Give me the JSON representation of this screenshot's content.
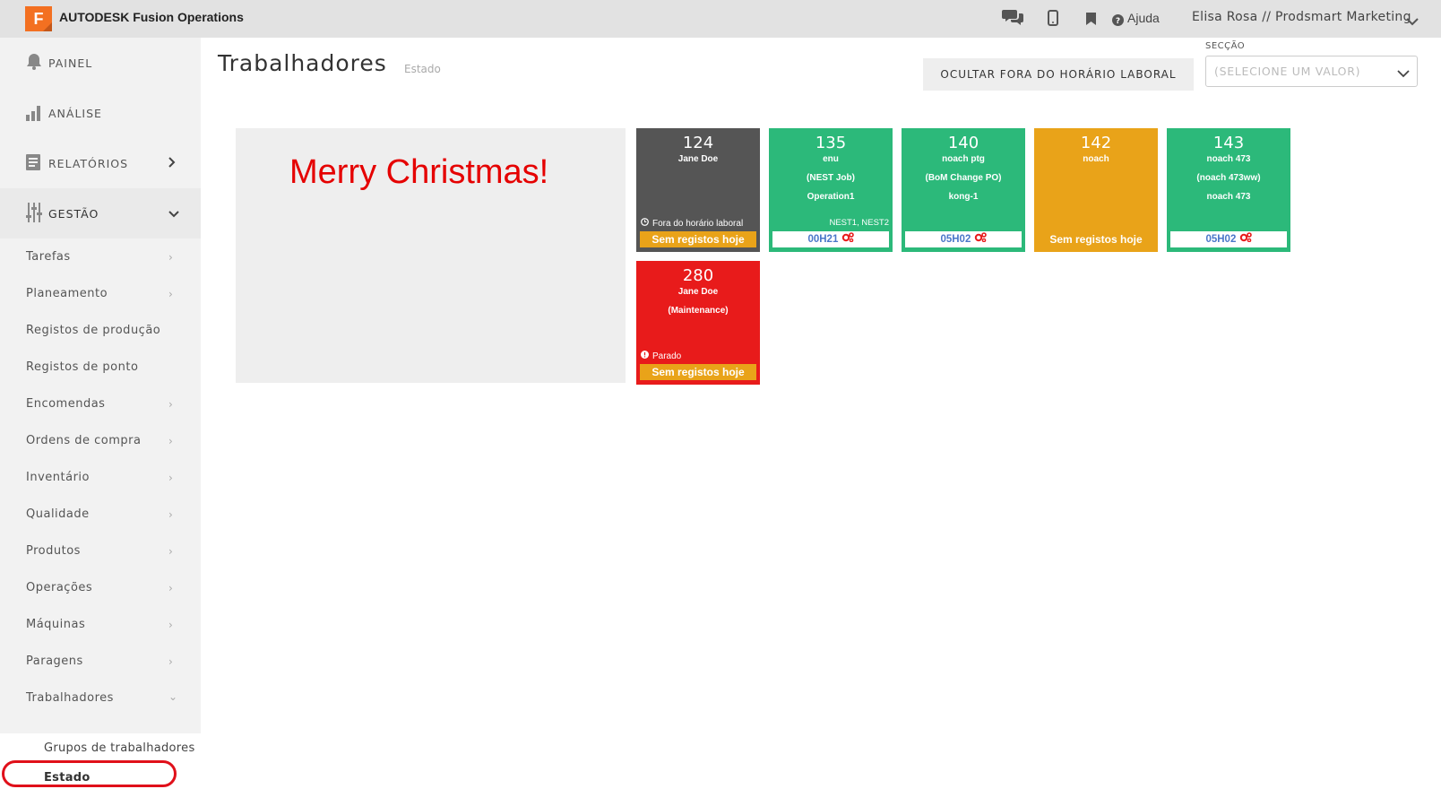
{
  "app": {
    "brand": "AUTODESK Fusion Operations",
    "logo_letter": "F",
    "help_label": "Ajuda",
    "user_label": "Elisa Rosa // Prodsmart Marketing"
  },
  "sidebar": {
    "main": [
      {
        "label": "PAINEL",
        "icon": "bell-icon"
      },
      {
        "label": "ANÁLISE",
        "icon": "bar-chart-icon"
      },
      {
        "label": "RELATÓRIOS",
        "icon": "report-icon"
      },
      {
        "label": "GESTÃO",
        "icon": "sliders-icon"
      }
    ],
    "items": [
      {
        "label": "Tarefas",
        "chevron": true
      },
      {
        "label": "Planeamento",
        "chevron": true
      },
      {
        "label": "Registos de produção",
        "chevron": false
      },
      {
        "label": "Registos de ponto",
        "chevron": false
      },
      {
        "label": "Encomendas",
        "chevron": true
      },
      {
        "label": "Ordens de compra",
        "chevron": true
      },
      {
        "label": "Inventário",
        "chevron": true
      },
      {
        "label": "Qualidade",
        "chevron": true
      },
      {
        "label": "Produtos",
        "chevron": true
      },
      {
        "label": "Operações",
        "chevron": true
      },
      {
        "label": "Máquinas",
        "chevron": true
      },
      {
        "label": "Paragens",
        "chevron": true
      },
      {
        "label": "Trabalhadores",
        "chevron": true
      }
    ],
    "subitems": [
      {
        "label": "Grupos de trabalhadores"
      },
      {
        "label": "Estado"
      }
    ]
  },
  "main": {
    "title": "Trabalhadores",
    "subtitle": "Estado",
    "hide_button": "OCULTAR FORA DO HORÁRIO LABORAL",
    "section_label": "SECÇÃO",
    "section_placeholder": "(SELECIONE UM VALOR)",
    "banner_text": "Merry Christmas!"
  },
  "workers": [
    {
      "number": "124",
      "name": "Jane Doe",
      "status": "Fora do horário laboral",
      "footer": "Sem registos hoje",
      "color": "#555555"
    },
    {
      "number": "135",
      "name": "enu",
      "job": "(NEST Job)",
      "operation": "Operation1",
      "tags": "NEST1, NEST2",
      "time": "00H21",
      "color": "#2cb97a"
    },
    {
      "number": "140",
      "name": "noach ptg",
      "job": "(BoM Change PO)",
      "operation": "kong-1",
      "time": "05H02",
      "color": "#2cb97a"
    },
    {
      "number": "142",
      "name": "noach",
      "footer": "Sem registos hoje",
      "color": "#e9a319"
    },
    {
      "number": "143",
      "name": "noach 473",
      "job": "(noach 473ww)",
      "operation": "noach 473",
      "time": "05H02",
      "color": "#2cb97a"
    },
    {
      "number": "280",
      "name": "Jane Doe",
      "job": "(Maintenance)",
      "status": "Parado",
      "footer": "Sem registos hoje",
      "color": "#e81b1b"
    }
  ]
}
